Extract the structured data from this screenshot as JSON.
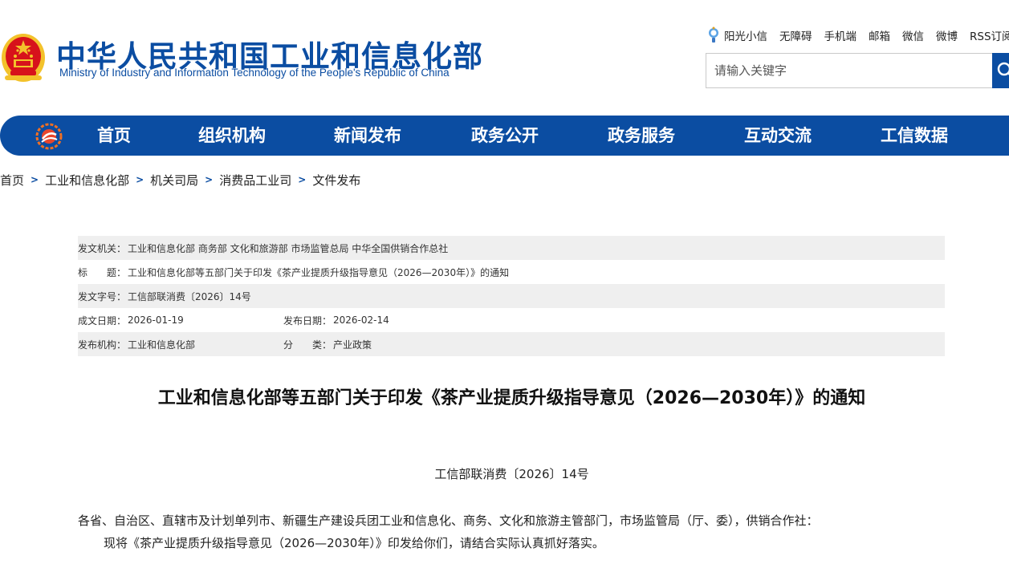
{
  "header": {
    "site_title": "中华人民共和国工业和信息化部",
    "site_subtitle": "Ministry of Industry and Information Technology of the People's Republic of China",
    "quicklinks": [
      "阳光小信",
      "无障碍",
      "手机端",
      "邮箱",
      "微信",
      "微博",
      "RSS订阅"
    ],
    "search_placeholder": "请输入关键字"
  },
  "nav": {
    "items": [
      "首页",
      "组织机构",
      "新闻发布",
      "政务公开",
      "政务服务",
      "互动交流",
      "工信数据"
    ]
  },
  "breadcrumb": [
    "首页",
    "工业和信息化部",
    "机关司局",
    "消费品工业司",
    "文件发布"
  ],
  "meta": {
    "issuer_label": "发文机关：",
    "issuer": "工业和信息化部 商务部 文化和旅游部 市场监管总局 中华全国供销合作总社",
    "title_label": "标　　题：",
    "title": "工业和信息化部等五部门关于印发《茶产业提质升级指导意见（2026—2030年）》的通知",
    "docno_label": "发文字号：",
    "docno": "工信部联消费〔2026〕14号",
    "created_label": "成文日期：",
    "created": "2026-01-19",
    "published_label": "发布日期：",
    "published": "2026-02-14",
    "org_label": "发布机构：",
    "org": "工业和信息化部",
    "category_label": "分　　类：",
    "category": "产业政策"
  },
  "article": {
    "title": "工业和信息化部等五部门关于印发《茶产业提质升级指导意见（2026—2030年）》的通知",
    "doc_number": "工信部联消费〔2026〕14号",
    "para1": "各省、自治区、直辖市及计划单列市、新疆生产建设兵团工业和信息化、商务、文化和旅游主管部门，市场监管局（厅、委），供销合作社：",
    "para2": "现将《茶产业提质升级指导意见（2026—2030年）》印发给你们，请结合实际认真抓好落实。"
  },
  "colors": {
    "brand_blue": "#0b4da2",
    "emblem_red": "#d7121b",
    "emblem_gold": "#f3c22b",
    "meta_shade": "#efefef"
  },
  "icons": {
    "emblem": "national-emblem-icon",
    "mascot": "mascot-icon",
    "search": "search-icon",
    "nav_logo": "ministry-logo-icon"
  }
}
